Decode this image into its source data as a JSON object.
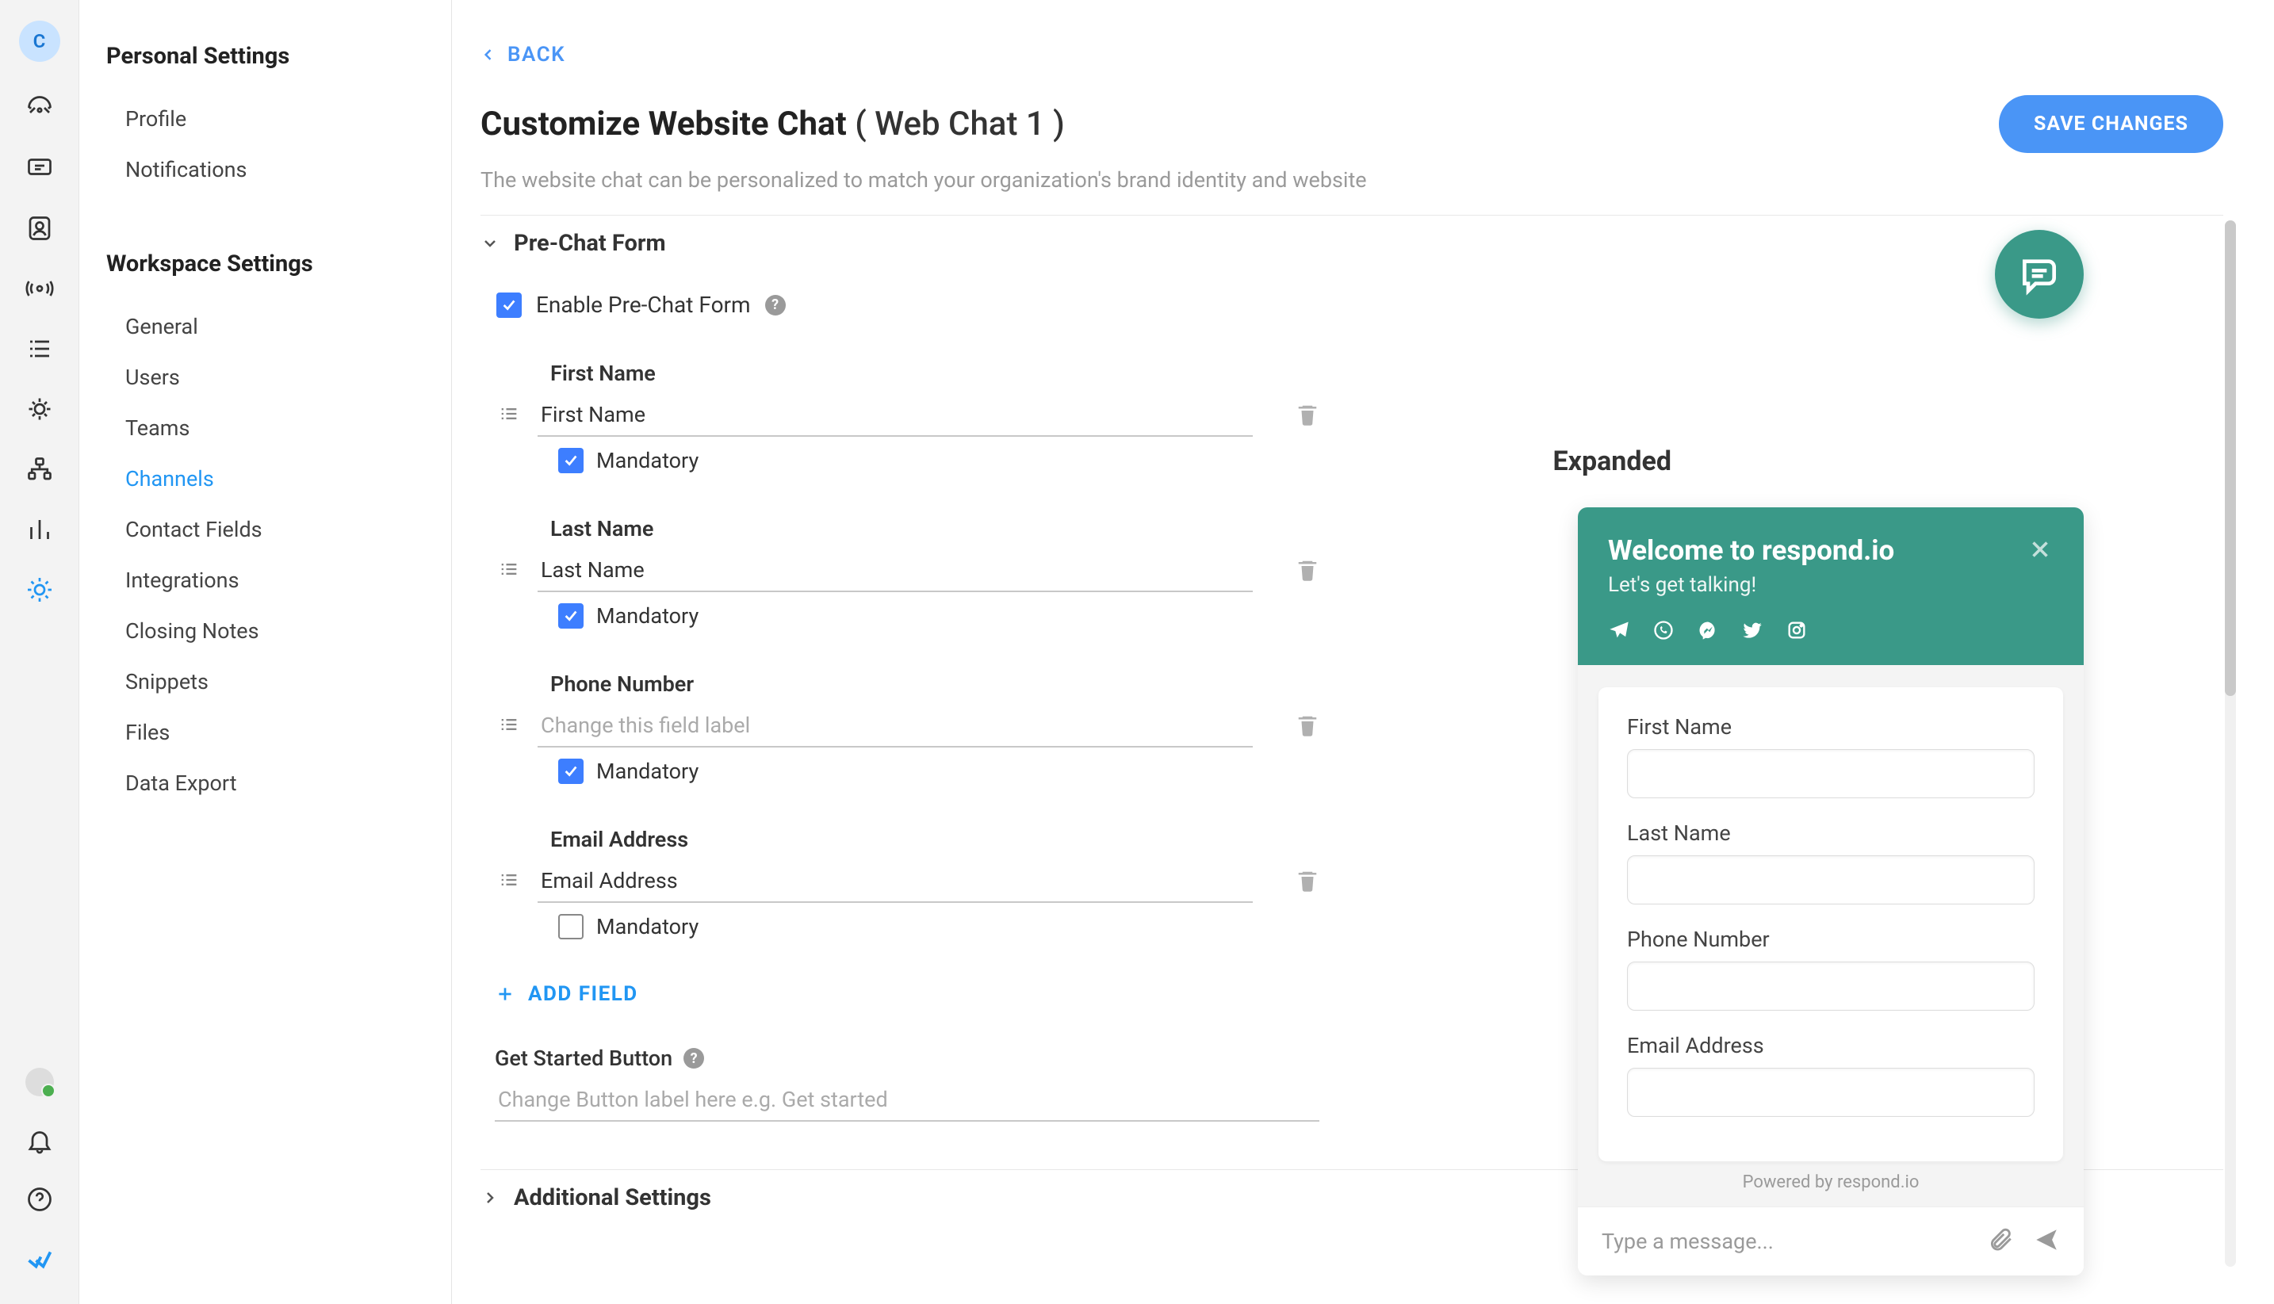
{
  "avatar_initial": "C",
  "back_label": "BACK",
  "page_title_prefix": "Customize Website Chat ",
  "page_title_suffix": "( Web Chat 1 )",
  "save_label": "SAVE CHANGES",
  "page_description": "The website chat can be personalized to match your organization's brand identity and website",
  "section_personal": {
    "heading": "Personal Settings",
    "items": [
      {
        "label": "Profile"
      },
      {
        "label": "Notifications"
      }
    ]
  },
  "section_workspace": {
    "heading": "Workspace Settings",
    "items": [
      {
        "label": "General"
      },
      {
        "label": "Users"
      },
      {
        "label": "Teams"
      },
      {
        "label": "Channels",
        "active": true
      },
      {
        "label": "Contact Fields"
      },
      {
        "label": "Integrations"
      },
      {
        "label": "Closing Notes"
      },
      {
        "label": "Snippets"
      },
      {
        "label": "Files"
      },
      {
        "label": "Data Export"
      }
    ]
  },
  "pre_chat_heading": "Pre-Chat Form",
  "enable_label": "Enable Pre-Chat Form",
  "mandatory_label": "Mandatory",
  "fields": [
    {
      "name": "First Name",
      "value": "First Name",
      "placeholder": "",
      "mandatory": true
    },
    {
      "name": "Last Name",
      "value": "Last Name",
      "placeholder": "",
      "mandatory": true
    },
    {
      "name": "Phone Number",
      "value": "",
      "placeholder": "Change this field label",
      "mandatory": true
    },
    {
      "name": "Email Address",
      "value": "Email Address",
      "placeholder": "",
      "mandatory": false
    }
  ],
  "add_field_label": "ADD FIELD",
  "get_started_label": "Get Started Button",
  "get_started_placeholder": "Change Button label here e.g. Get started",
  "additional_settings": "Additional Settings",
  "preview_mode": "Expanded",
  "chat": {
    "title": "Welcome to respond.io",
    "subtitle": "Let's get talking!",
    "form_labels": [
      "First Name",
      "Last Name",
      "Phone Number",
      "Email Address"
    ],
    "powered": "Powered by respond.io",
    "input_placeholder": "Type a message..."
  }
}
